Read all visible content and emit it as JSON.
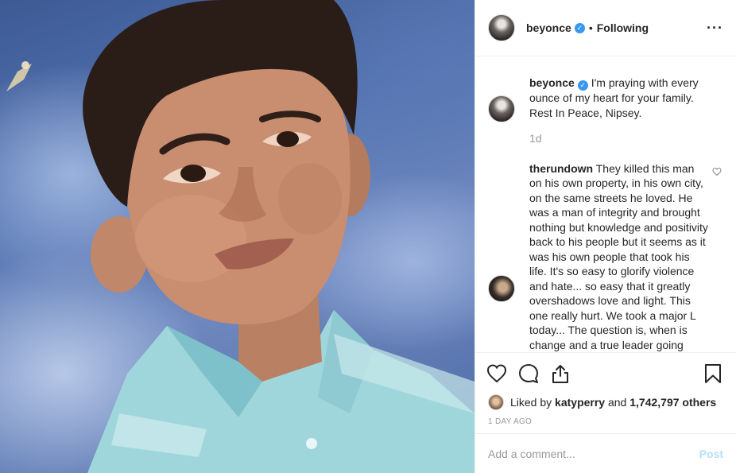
{
  "post": {
    "author": "beyonce",
    "follow_status": "Following",
    "more_icon": "more-options-icon",
    "image_subject": "child-school-portrait"
  },
  "caption": {
    "username": "beyonce",
    "text": "I'm praying with every ounce of my heart for your family. Rest In Peace, Nipsey.",
    "time": "1d"
  },
  "comments": [
    {
      "username": "therundown",
      "text": "They killed this man on his own property, in his own city, on the same streets he loved. He was a man of integrity and brought nothing but knowledge and positivity back to his people but it seems as it was his own people that took his life. It's so easy to glorify violence and hate... so easy that it greatly overshadows love and light. This one really hurt. We took a major L today... The question is, when is change and a true leader going"
    }
  ],
  "likes": {
    "prefix": "Liked by",
    "user": "katyperry",
    "connector": "and",
    "others": "1,742,797 others"
  },
  "post_age": "1 DAY AGO",
  "add_comment": {
    "placeholder": "Add a comment...",
    "post_label": "Post"
  },
  "colors": {
    "verified": "#3897f0",
    "post_button_disabled": "#b2dffc",
    "muted_text": "#999999",
    "border": "#efefef"
  }
}
